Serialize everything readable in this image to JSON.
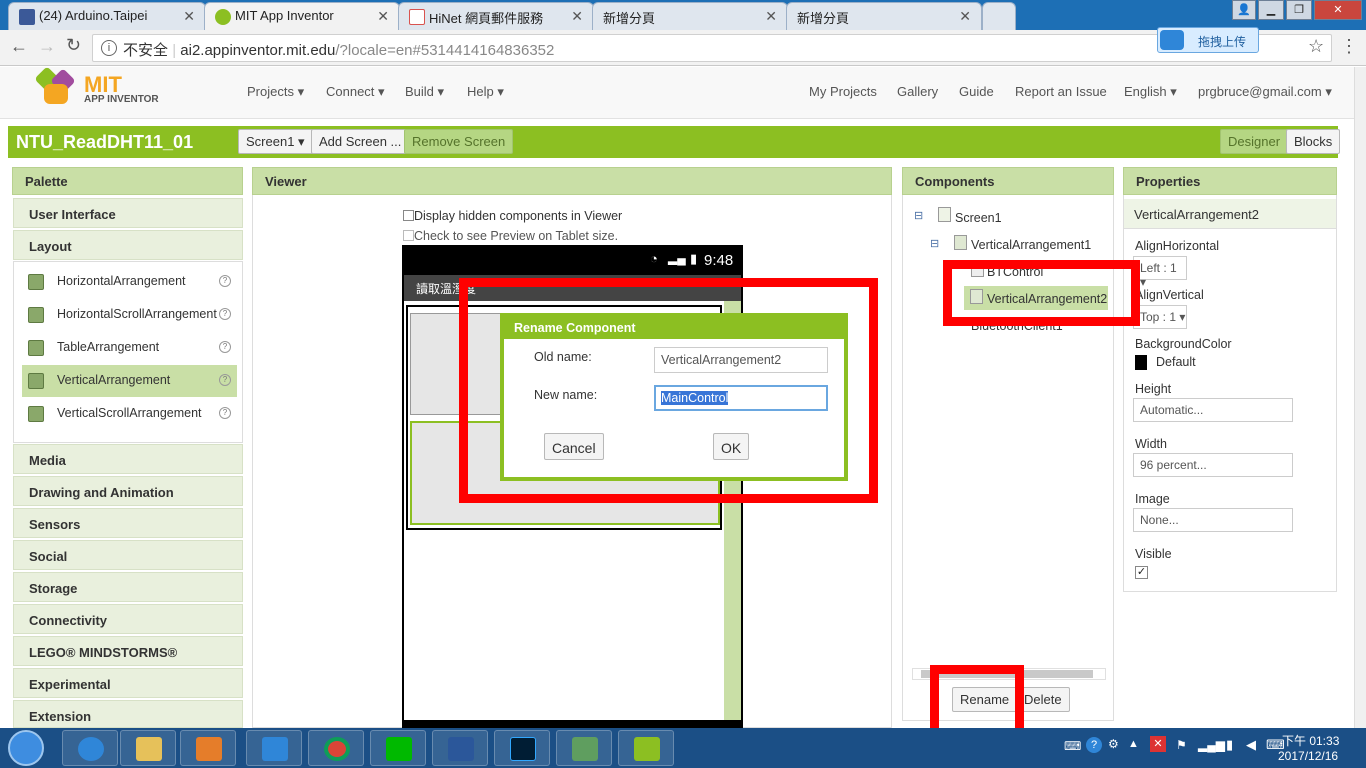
{
  "browser": {
    "tabs": [
      {
        "title": "(24) Arduino.Taipei",
        "icon_color": "#3b5998"
      },
      {
        "title": "MIT App Inventor",
        "icon_color": "#8cbf22"
      },
      {
        "title": "HiNet 網頁郵件服務",
        "icon_color": "#d9534f"
      },
      {
        "title": "新增分頁",
        "icon_color": ""
      },
      {
        "title": "新增分頁",
        "icon_color": ""
      }
    ],
    "security": "不安全",
    "url_host": "ai2.appinventor.mit.edu",
    "url_rest": "/?locale=en#5314414164836352",
    "upload_badge": "拖拽上传"
  },
  "app": {
    "logo_top": "MIT",
    "logo_bottom": "APP INVENTOR",
    "menu_left": [
      "Projects",
      "Connect",
      "Build",
      "Help"
    ],
    "menu_right": [
      "My Projects",
      "Gallery",
      "Guide",
      "Report an Issue",
      "English",
      "prgbruce@gmail.com"
    ],
    "project_name": "NTU_ReadDHT11_01",
    "screen_select": "Screen1",
    "add_screen": "Add Screen ...",
    "remove_screen": "Remove Screen",
    "designer": "Designer",
    "blocks": "Blocks"
  },
  "palette": {
    "title": "Palette",
    "categories_top": [
      "User Interface",
      "Layout"
    ],
    "layout_items": [
      "HorizontalArrangement",
      "HorizontalScrollArrangement",
      "TableArrangement",
      "VerticalArrangement",
      "VerticalScrollArrangement"
    ],
    "categories_bottom": [
      "Media",
      "Drawing and Animation",
      "Sensors",
      "Social",
      "Storage",
      "Connectivity",
      "LEGO® MINDSTORMS®",
      "Experimental",
      "Extension"
    ]
  },
  "viewer": {
    "title": "Viewer",
    "chk_hidden": "Display hidden components in Viewer",
    "chk_tablet": "Check to see Preview on Tablet size.",
    "phone_time": "9:48",
    "phone_title": "讀取溫溼度"
  },
  "components": {
    "title": "Components",
    "tree": [
      "Screen1",
      "VerticalArrangement1",
      "BTControl",
      "VerticalArrangement2",
      "BluetoothClient1"
    ],
    "rename": "Rename",
    "delete": "Delete"
  },
  "properties": {
    "title": "Properties",
    "component": "VerticalArrangement2",
    "align_h_label": "AlignHorizontal",
    "align_h": "Left : 1",
    "align_v_label": "AlignVertical",
    "align_v": "Top : 1",
    "bg_label": "BackgroundColor",
    "bg_value": "Default",
    "height_label": "Height",
    "height_value": "Automatic...",
    "width_label": "Width",
    "width_value": "96 percent...",
    "image_label": "Image",
    "image_value": "None...",
    "visible_label": "Visible"
  },
  "dialog": {
    "title": "Rename Component",
    "old_label": "Old name:",
    "old_value": "VerticalArrangement2",
    "new_label": "New name:",
    "new_value": "MainControl",
    "cancel": "Cancel",
    "ok": "OK"
  },
  "taskbar": {
    "time": "下午 01:33",
    "date": "2017/12/16"
  }
}
